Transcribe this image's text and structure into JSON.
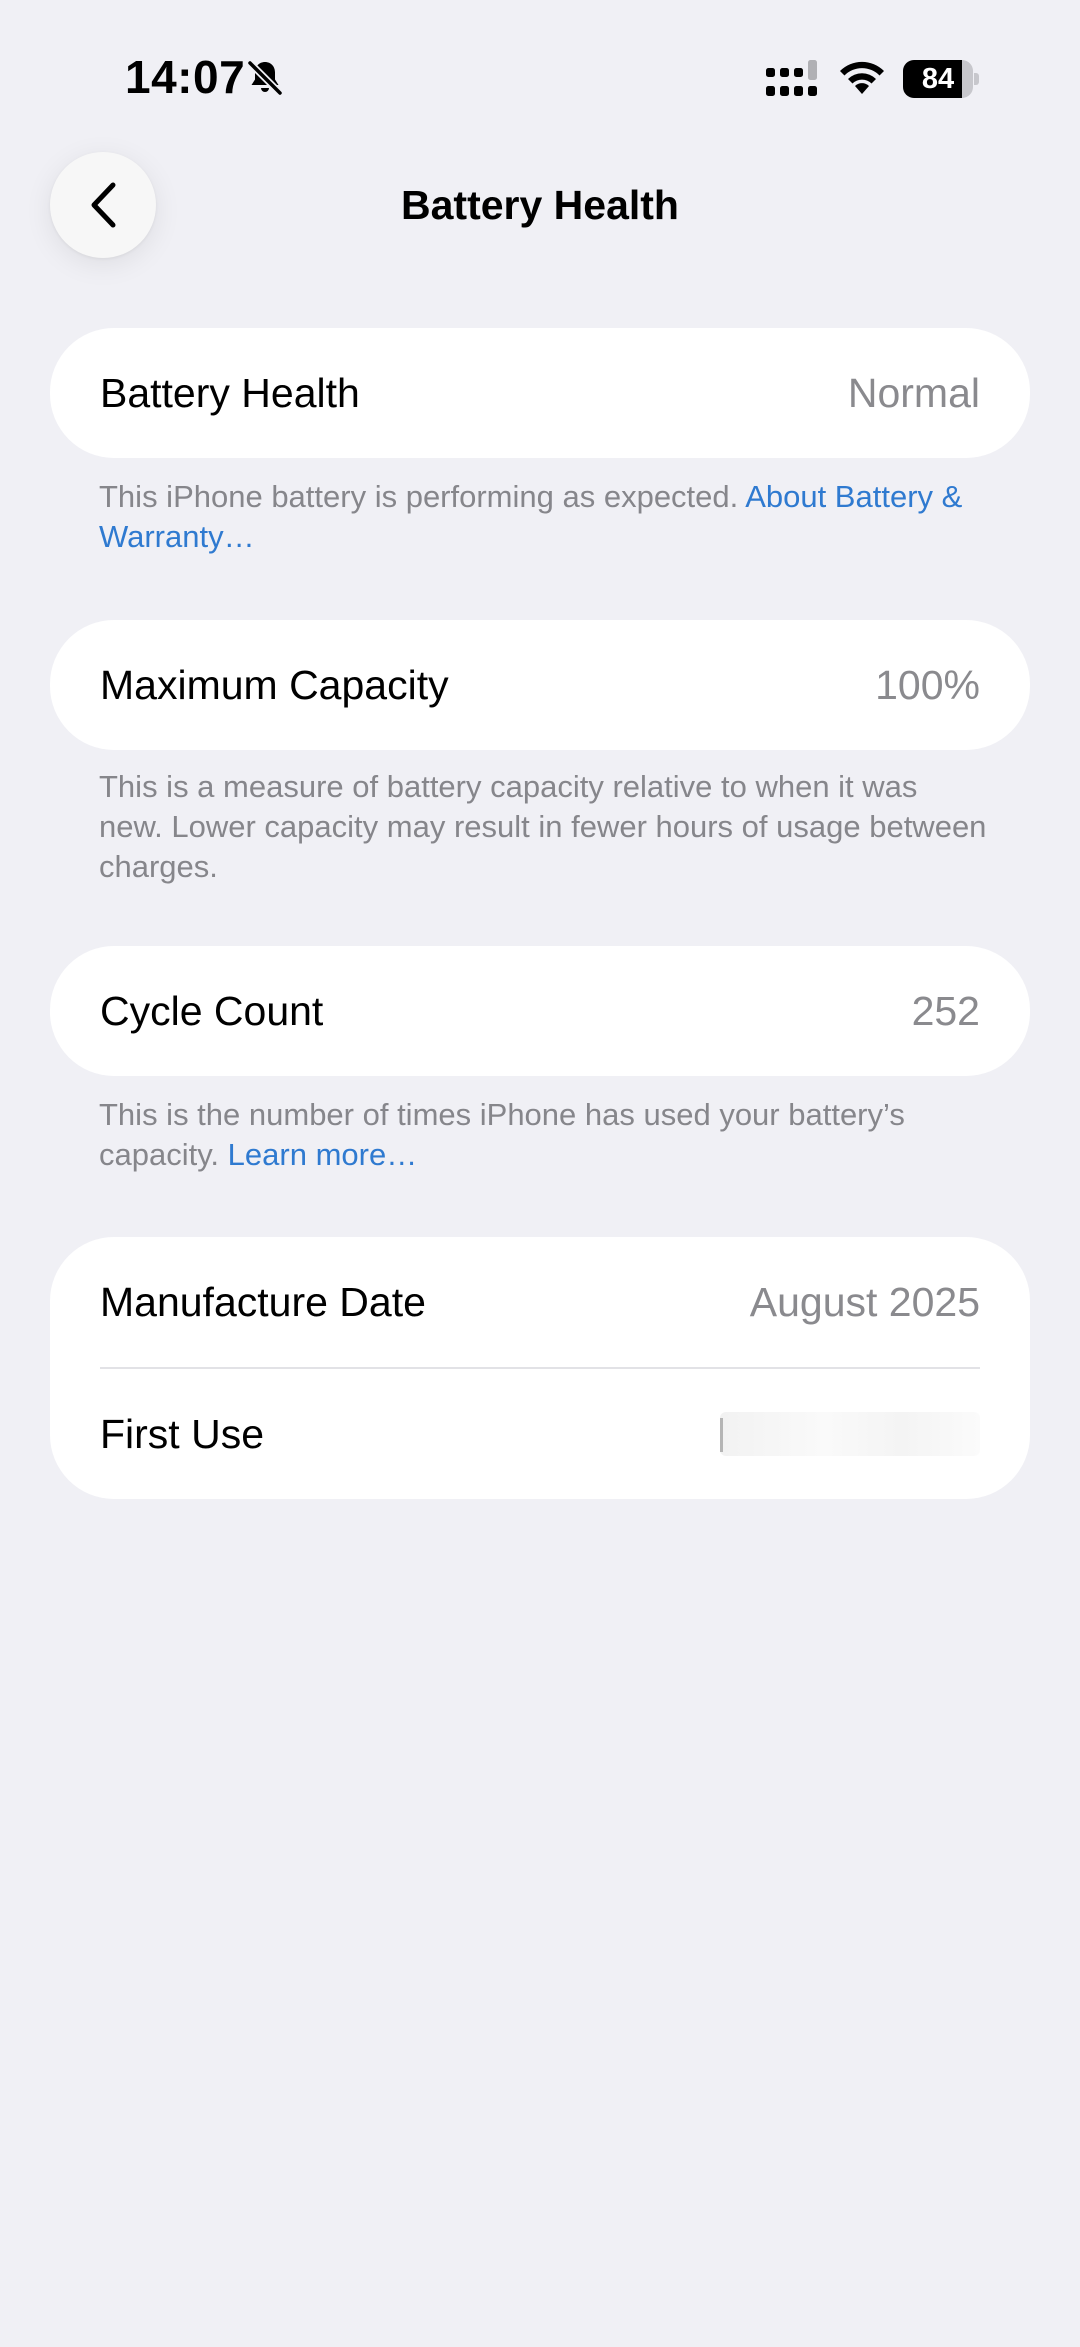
{
  "status_bar": {
    "time": "14:07",
    "battery_level": "84",
    "battery_fraction": 0.84,
    "icons": [
      "bell-slash-icon",
      "cellular-signal-icon",
      "wifi-icon",
      "battery-icon"
    ]
  },
  "nav": {
    "title": "Battery Health",
    "back_icon": "chevron-left-icon"
  },
  "sections": {
    "health": {
      "label": "Battery Health",
      "value": "Normal",
      "footnote": "This iPhone battery is performing as expected.",
      "link": "About Battery & Warranty…"
    },
    "capacity": {
      "label": "Maximum Capacity",
      "value": "100%",
      "footnote": "This is a measure of battery capacity relative to when it was new. Lower capacity may result in fewer hours of usage between charges."
    },
    "cycles": {
      "label": "Cycle Count",
      "value": "252",
      "footnote": "This is the number of times iPhone has used your battery’s capacity.",
      "link": "Learn more…"
    },
    "dates": {
      "manufacture_label": "Manufacture Date",
      "manufacture_value": "August 2025",
      "first_use_label": "First Use"
    }
  },
  "colors": {
    "background": "#f0f0f5",
    "card": "#ffffff",
    "secondary_text": "#8a8a8e",
    "link": "#2f7ad0"
  }
}
